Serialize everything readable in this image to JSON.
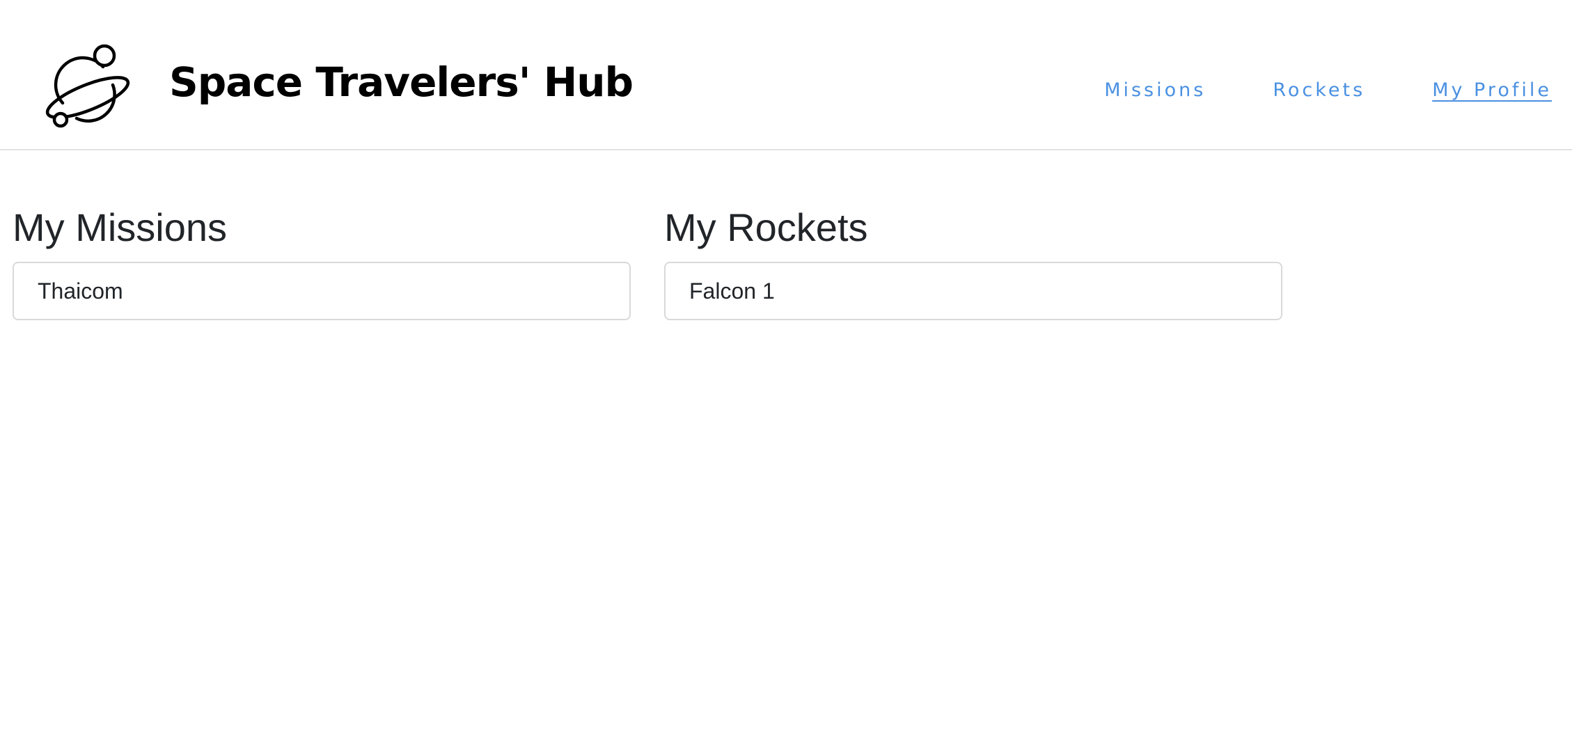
{
  "header": {
    "brand_title": "Space Travelers' Hub",
    "logo_icon": "planet-icon"
  },
  "nav": {
    "items": [
      {
        "label": "Missions",
        "active": false
      },
      {
        "label": "Rockets",
        "active": false
      },
      {
        "label": "My Profile",
        "active": true
      }
    ],
    "link_color": "#4a90e2"
  },
  "profile": {
    "missions": {
      "title": "My Missions",
      "items": [
        "Thaicom"
      ]
    },
    "rockets": {
      "title": "My Rockets",
      "items": [
        "Falcon 1"
      ]
    }
  }
}
